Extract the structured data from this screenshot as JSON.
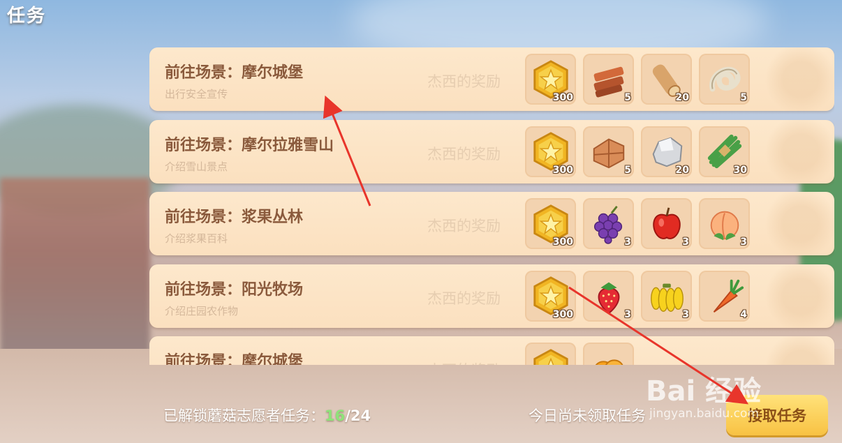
{
  "header": {
    "title": "任务"
  },
  "tasks": [
    {
      "name": "前往场景：摩尔城堡",
      "description": "出行安全宣传",
      "reward_label": "杰西的奖励",
      "rewards": [
        {
          "icon": "gold-coin-icon",
          "count": "300"
        },
        {
          "icon": "wood-planks-icon",
          "count": "5"
        },
        {
          "icon": "log-icon",
          "count": "20"
        },
        {
          "icon": "rope-icon",
          "count": "5"
        }
      ]
    },
    {
      "name": "前往场景：摩尔拉雅雪山",
      "description": "介绍雪山景点",
      "reward_label": "杰西的奖励",
      "rewards": [
        {
          "icon": "gold-coin-icon",
          "count": "300"
        },
        {
          "icon": "stone-bricks-icon",
          "count": "5"
        },
        {
          "icon": "rock-icon",
          "count": "20"
        },
        {
          "icon": "grass-bundle-icon",
          "count": "30"
        }
      ]
    },
    {
      "name": "前往场景：浆果丛林",
      "description": "介绍浆果百科",
      "reward_label": "杰西的奖励",
      "rewards": [
        {
          "icon": "gold-coin-icon",
          "count": "300"
        },
        {
          "icon": "grapes-icon",
          "count": "3"
        },
        {
          "icon": "apple-icon",
          "count": "3"
        },
        {
          "icon": "peach-icon",
          "count": "3"
        }
      ]
    },
    {
      "name": "前往场景：阳光牧场",
      "description": "介绍庄园农作物",
      "reward_label": "杰西的奖励",
      "rewards": [
        {
          "icon": "gold-coin-icon",
          "count": "300"
        },
        {
          "icon": "strawberry-icon",
          "count": "3"
        },
        {
          "icon": "banana-icon",
          "count": "3"
        },
        {
          "icon": "carrot-icon",
          "count": "4"
        }
      ]
    },
    {
      "name": "前往场景：摩尔城堡",
      "description": "",
      "reward_label": "杰西的奖励",
      "rewards": [
        {
          "icon": "gold-coin-icon",
          "count": ""
        },
        {
          "icon": "orange-fruit-icon",
          "count": ""
        }
      ]
    }
  ],
  "footer": {
    "progress_label": "已解锁蘑菇志愿者任务：",
    "progress_done": "16",
    "progress_total": "/24",
    "status_text": "今日尚未领取任务",
    "claim_button": "接取任务"
  },
  "watermark": {
    "main": "Bai  经验",
    "sub": "jingyan.baidu.com"
  },
  "colors": {
    "card_bg": "#fde8cc",
    "title_text": "#8a5a3c",
    "progress_done": "#8fe27a",
    "button": "#f8c243"
  }
}
